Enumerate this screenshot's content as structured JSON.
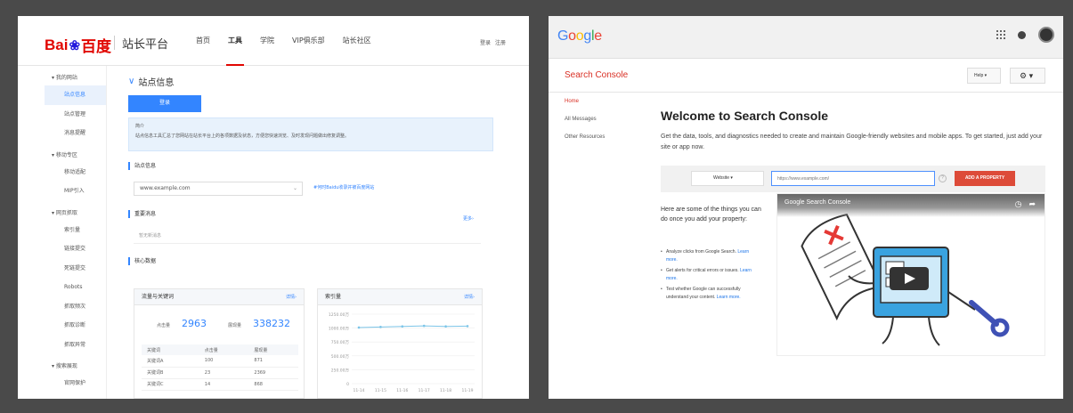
{
  "baidu": {
    "logo": {
      "left": "Bai",
      "paw": "❀",
      "right": "百度"
    },
    "platform": "站长平台",
    "nav": [
      "首页",
      "工具",
      "学院",
      "VIP俱乐部",
      "站长社区"
    ],
    "nav_active": 1,
    "login": [
      "登录",
      "注册"
    ],
    "sidebar": [
      {
        "type": "grp",
        "label": "▾ 我的网站"
      },
      {
        "type": "item",
        "label": "站点信息",
        "selected": true
      },
      {
        "type": "item",
        "label": "站点管理"
      },
      {
        "type": "item",
        "label": "消息提醒"
      },
      {
        "type": "grp",
        "label": "▾ 移动专区"
      },
      {
        "type": "item",
        "label": "移动适配"
      },
      {
        "type": "item",
        "label": "MIP引入"
      },
      {
        "type": "grp",
        "label": "▾ 网页抓取"
      },
      {
        "type": "item",
        "label": "索引量"
      },
      {
        "type": "item",
        "label": "链接提交"
      },
      {
        "type": "item",
        "label": "死链提交"
      },
      {
        "type": "item",
        "label": "Robots"
      },
      {
        "type": "item",
        "label": "抓取频次"
      },
      {
        "type": "item",
        "label": "抓取诊断"
      },
      {
        "type": "item",
        "label": "抓取异常"
      },
      {
        "type": "grp",
        "label": "▾ 搜索展现"
      },
      {
        "type": "item",
        "label": "官网保护"
      }
    ],
    "title": "站点信息",
    "btn": "登录",
    "info_title": "简介",
    "info_text": "站点信息工具汇总了您网站在站长平台上的各项数据及状态，方便您快速浏览、及时发现问题做出修复调整。",
    "sec_site": "站点信息",
    "site_select": "www.example.com",
    "site_link": "#何时Baidu收录并被百度网站",
    "sec_msg": "重要消息",
    "msg_more": "更多›",
    "msg_empty": "暂无新消息",
    "sec_core": "核心数据",
    "card_a": {
      "title": "流量与关键词",
      "more": "详情›",
      "stat1_label": "点击量",
      "stat1": "2963",
      "stat2_label": "展现量",
      "stat2": "338232",
      "cols": [
        "关键词",
        "点击量",
        "展现量"
      ],
      "rows": [
        [
          "关键词A",
          "100",
          "871"
        ],
        [
          "关键词B",
          "23",
          "2369"
        ],
        [
          "关键词C",
          "14",
          "868"
        ]
      ]
    },
    "card_b": {
      "title": "索引量",
      "more": "详情›"
    },
    "chart_data": {
      "type": "line",
      "title": "索引量",
      "x": [
        "11-14",
        "11-15",
        "11-16",
        "11-17",
        "11-18",
        "11-19"
      ],
      "yticks": [
        "1250.00万",
        "1000.00万",
        "750.00万",
        "500.00万",
        "250.00万",
        "0"
      ],
      "ylim": [
        0,
        1250
      ],
      "series": [
        {
          "values": [
            1010,
            1020,
            1030,
            1040,
            1030,
            1035
          ]
        }
      ],
      "color": "#7cc5e8"
    }
  },
  "google": {
    "logo": [
      {
        "ch": "G",
        "color": "#4285f4"
      },
      {
        "ch": "o",
        "color": "#ea4335"
      },
      {
        "ch": "o",
        "color": "#fbbc05"
      },
      {
        "ch": "g",
        "color": "#4285f4"
      },
      {
        "ch": "l",
        "color": "#34a853"
      },
      {
        "ch": "e",
        "color": "#ea4335"
      }
    ],
    "brand": "Search Console",
    "help": "Help ▾",
    "gear": "⚙ ▾",
    "nav": [
      "Home",
      "All Messages",
      "Other Resources"
    ],
    "heading": "Welcome to Search Console",
    "desc": "Get the data, tools, and diagnostics needed to create and maintain Google-friendly websites and mobile apps. To get started, just add your site or app now.",
    "type_select": "Website ▾",
    "url_placeholder": "https://www.example.com/",
    "add_btn": "ADD A PROPERTY",
    "things": "Here are some of the things you can do once you add your property:",
    "list": [
      {
        "text": "Analyze clicks from Google Search.",
        "link": "Learn more."
      },
      {
        "text": "Get alerts for critical errors or issues.",
        "link": "Learn more."
      },
      {
        "text": "Test whether Google can successfully understand your content.",
        "link": "Learn more."
      }
    ],
    "video_title": "Google Search Console",
    "video_icons": [
      "◷",
      "➦"
    ]
  }
}
